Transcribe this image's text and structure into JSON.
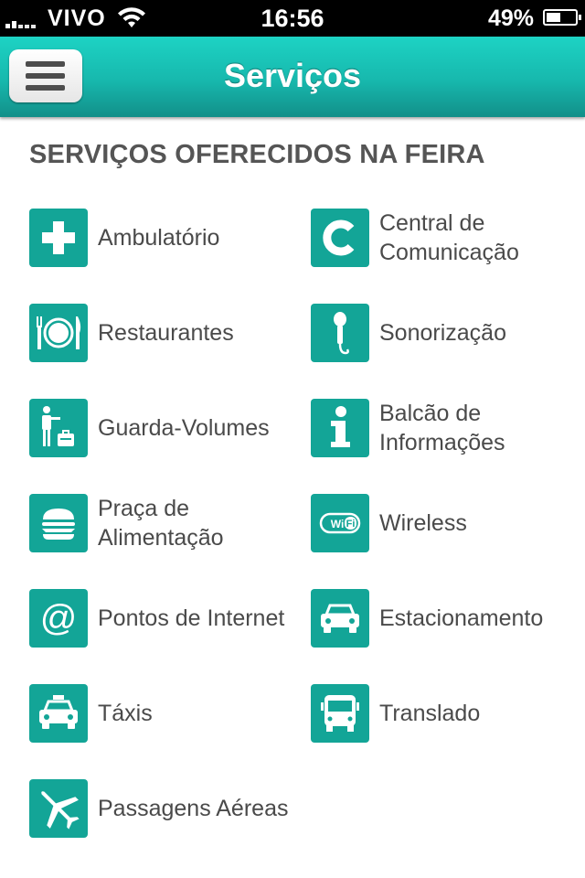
{
  "status_bar": {
    "carrier": "VIVO",
    "time": "16:56",
    "battery": "49%",
    "battery_level": 0.49
  },
  "nav": {
    "menu_icon": "hamburger-menu-icon",
    "title": "Serviços"
  },
  "section_title": "SERVIÇOS OFERECIDOS NA FEIRA",
  "accent_color": "#13a597",
  "services": [
    {
      "label": "Ambulatório",
      "icon": "first-aid-cross-icon"
    },
    {
      "label": "Central de Comunicação",
      "icon": "letter-c-icon"
    },
    {
      "label": "Restaurantes",
      "icon": "plate-cutlery-icon"
    },
    {
      "label": "Sonorização",
      "icon": "microphone-icon"
    },
    {
      "label": "Guarda-Volumes",
      "icon": "luggage-storage-icon"
    },
    {
      "label": "Balcão de Informações",
      "icon": "info-icon"
    },
    {
      "label": "Praça de Alimentação",
      "icon": "burger-icon"
    },
    {
      "label": "Wireless",
      "icon": "wifi-icon"
    },
    {
      "label": "Pontos de Internet",
      "icon": "at-sign-icon"
    },
    {
      "label": "Estacionamento",
      "icon": "car-icon"
    },
    {
      "label": "Táxis",
      "icon": "taxi-icon"
    },
    {
      "label": "Translado",
      "icon": "bus-icon"
    },
    {
      "label": "Passagens Aéreas",
      "icon": "airplane-icon"
    }
  ]
}
